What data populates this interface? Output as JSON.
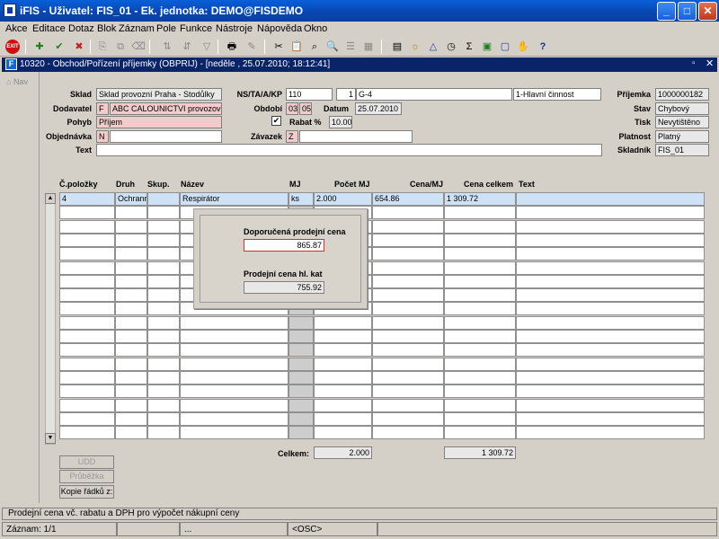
{
  "window": {
    "title": "iFIS - Uživatel: FIS_01 - Ek. jednotka: DEMO@FISDEMO"
  },
  "menu": [
    "Akce",
    "Editace",
    "Dotaz",
    "Blok",
    "Záznam",
    "Pole",
    "Funkce",
    "Nástroje",
    "Nápověda",
    "Okno"
  ],
  "inner_window": {
    "title": "10320 - Obchod/Pořízení příjemky (OBPRIJ) - [neděle , 25.07.2010; 18:12:41]"
  },
  "sidebar": {
    "nav_label": "Nav"
  },
  "header": {
    "sklad": {
      "label": "Sklad",
      "value": "Sklad provozní Praha - Stodůlky"
    },
    "dodavatel": {
      "label": "Dodavatel",
      "code": "F",
      "value": "ABC CALOUNICTVI provozovna"
    },
    "pohyb": {
      "label": "Pohyb",
      "value": "Příjem"
    },
    "objednavka": {
      "label": "Objednávka",
      "code": "N",
      "value": ""
    },
    "text": {
      "label": "Text",
      "value": ""
    },
    "ns": {
      "label": "NS/TA/A/KP",
      "v1": "110",
      "v2": "1",
      "v3": "G-4",
      "v4": "1-Hlavní činnost"
    },
    "obdobi": {
      "label": "Období",
      "v1": "03",
      "v2": "05"
    },
    "datum": {
      "label": "Datum",
      "value": "25.07.2010"
    },
    "rabat": {
      "label": "Rabat %",
      "value": "10.00",
      "checked": "✔"
    },
    "zavazek": {
      "label": "Závazek",
      "code": "Z",
      "value": ""
    },
    "prijemka": {
      "label": "Příjemka",
      "value": "1000000182"
    },
    "stav": {
      "label": "Stav",
      "value": "Chybový"
    },
    "tisk": {
      "label": "Tisk",
      "value": "Nevytištěno"
    },
    "platnost": {
      "label": "Platnost",
      "value": "Platný"
    },
    "skladnik": {
      "label": "Skladník",
      "value": "FIS_01"
    }
  },
  "table": {
    "columns": [
      "Č.položky",
      "Druh",
      "Skup.",
      "Název",
      "MJ",
      "Počet MJ",
      "Cena/MJ",
      "Cena celkem",
      "Text"
    ],
    "row1": {
      "polozka": "4",
      "druh": "Ochranr",
      "skup": "",
      "nazev": "Respirátor",
      "mj": "ks",
      "pocet": "2.000",
      "cena": "654.86",
      "celkem": "1 309.72",
      "text": ""
    }
  },
  "totals": {
    "label": "Celkem:",
    "pocet": "2.000",
    "celkem": "1 309.72"
  },
  "popup": {
    "doporucena_label": "Doporučená prodejní cena",
    "doporucena_value": "865.87",
    "prodejni_label": "Prodejní cena hl. kat",
    "prodejni_value": "755.92"
  },
  "buttons": {
    "udd": "UDD",
    "prubezka": "Průběžka",
    "kopie": "Kopie řádků z:"
  },
  "status": {
    "message": "Prodejní cena vč. rabatu a DPH pro výpočet nákupní ceny"
  },
  "bottom": {
    "zaznam": "Záznam: 1/1",
    "dots": "...",
    "osc": "<OSC>"
  }
}
